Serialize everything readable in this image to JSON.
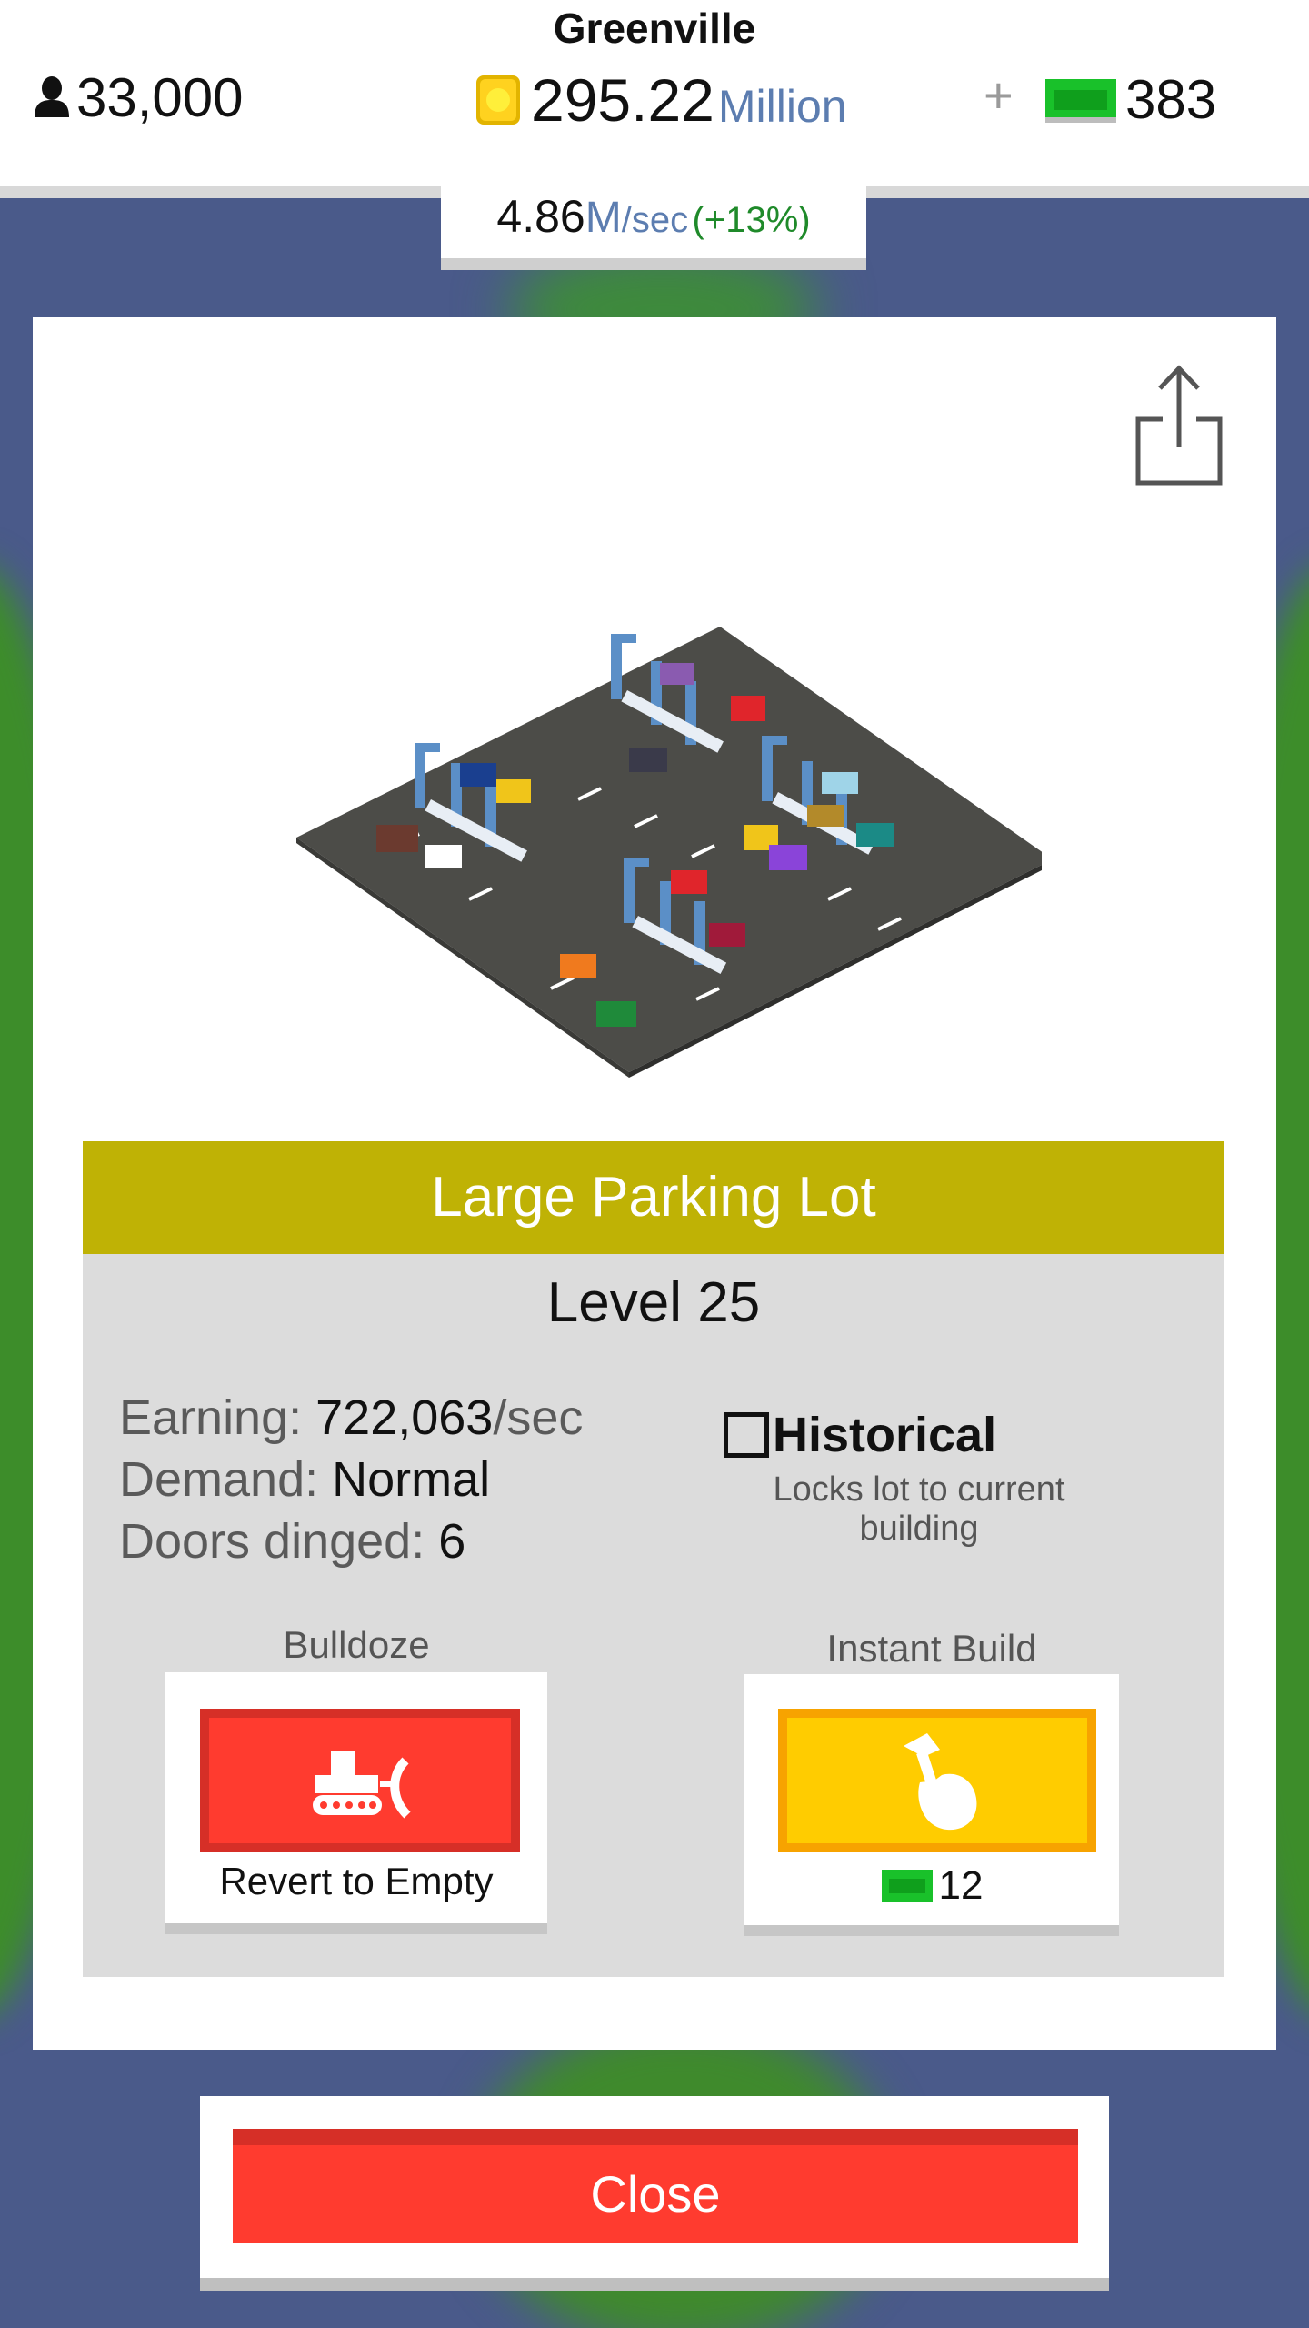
{
  "header": {
    "city_name": "Greenville",
    "population": "33,000",
    "coins": "295.22",
    "coins_unit": "Million",
    "plus": "+",
    "cash": "383",
    "rate_value": "4.86",
    "rate_unit": "M",
    "rate_per": "/sec",
    "rate_percent": "(+13%)"
  },
  "building": {
    "name": "Large Parking Lot",
    "level": "Level 25",
    "earning_label": "Earning: ",
    "earning_value": "722,063",
    "earning_unit": "/sec",
    "demand_label": "Demand: ",
    "demand_value": "Normal",
    "doors_label": "Doors dinged: ",
    "doors_value": "6",
    "historical_label": "Historical",
    "historical_checked": false,
    "historical_description": "Locks lot to current building"
  },
  "actions": {
    "bulldoze_label": "Bulldoze",
    "bulldoze_button_text": "Revert to Empty",
    "instant_build_label": "Instant Build",
    "instant_build_cost": "12"
  },
  "close_label": "Close",
  "icons": {
    "population": "person-icon",
    "coins": "coin-icon",
    "cash": "cash-icon",
    "share": "share-icon",
    "bulldozer": "bulldozer-icon",
    "hammer": "hammer-hand-icon"
  },
  "colors": {
    "title_bar": "#bfb205",
    "bulldoze": "#ff3b2f",
    "instant_build": "#ffcc00",
    "close": "#ff3b2f",
    "accent_blue": "#5c7db0",
    "percent_green": "#1f8a2a"
  }
}
